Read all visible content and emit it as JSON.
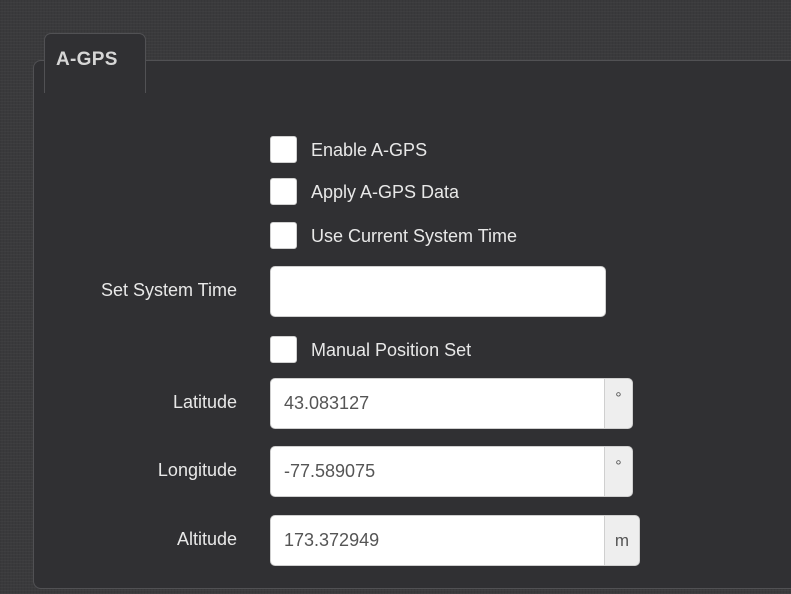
{
  "panel": {
    "tab_label": "A-GPS"
  },
  "options": {
    "enable_agps": {
      "label": "Enable A-GPS",
      "checked": false
    },
    "apply_agps_data": {
      "label": "Apply A-GPS Data",
      "checked": false
    },
    "use_current_system_time": {
      "label": "Use Current System Time",
      "checked": false
    },
    "manual_position_set": {
      "label": "Manual Position Set",
      "checked": false
    }
  },
  "fields": {
    "set_system_time": {
      "label": "Set System Time",
      "value": ""
    },
    "latitude": {
      "label": "Latitude",
      "value": "43.083127",
      "unit": "°"
    },
    "longitude": {
      "label": "Longitude",
      "value": "-77.589075",
      "unit": "°"
    },
    "altitude": {
      "label": "Altitude",
      "value": "173.372949",
      "unit": "m"
    }
  }
}
